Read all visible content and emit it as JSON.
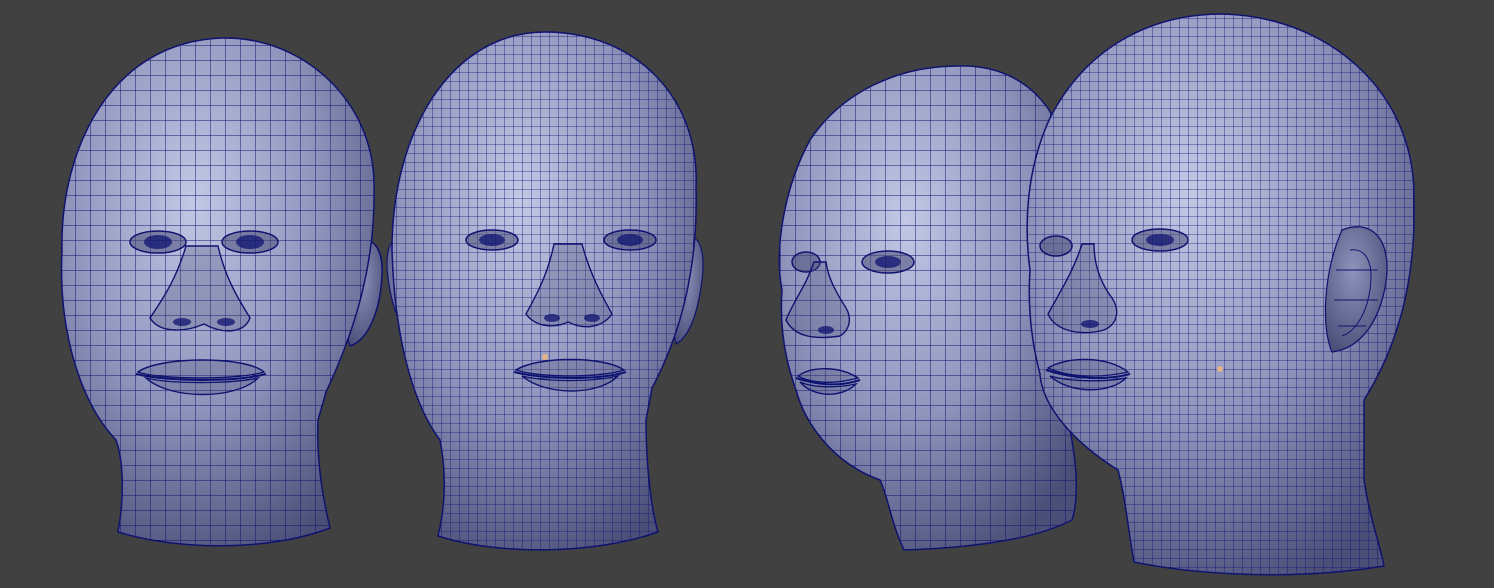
{
  "scene": {
    "background_color": "#414141",
    "surface_light": "#c3c8e6",
    "surface_mid": "#8e93bb",
    "surface_dark": "#4b4f78",
    "wire_color": "#0f1370",
    "vertex_marker_color": "#e2b58a"
  },
  "heads": [
    {
      "view": "front",
      "topology": "coarse",
      "has_ear": true,
      "has_marker": false
    },
    {
      "view": "front",
      "topology": "dense",
      "has_ear": true,
      "has_marker": true
    },
    {
      "view": "three-quarter",
      "topology": "coarse",
      "has_ear": false,
      "has_marker": false
    },
    {
      "view": "three-quarter",
      "topology": "dense",
      "has_ear": true,
      "has_marker": true
    }
  ]
}
